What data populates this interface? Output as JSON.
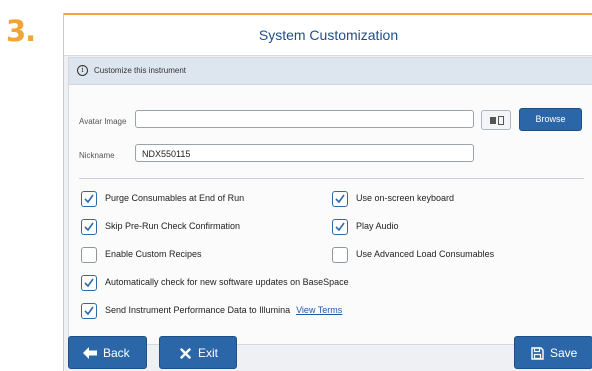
{
  "step_number": "3.",
  "window": {
    "title": "System Customization"
  },
  "info": {
    "text": "Customize this instrument"
  },
  "fields": {
    "avatar_label": "Avatar Image",
    "avatar_value": "",
    "nickname_label": "Nickname",
    "nickname_value": "NDX550115"
  },
  "buttons": {
    "browse": "Browse",
    "back": "Back",
    "exit": "Exit",
    "save": "Save"
  },
  "options": [
    {
      "label": "Purge Consumables at End of Run",
      "checked": true
    },
    {
      "label": "Use on-screen keyboard",
      "checked": true
    },
    {
      "label": "Skip Pre-Run Check Confirmation",
      "checked": true
    },
    {
      "label": "Play Audio",
      "checked": true
    },
    {
      "label": "Enable Custom Recipes",
      "checked": false
    },
    {
      "label": "Use Advanced Load Consumables",
      "checked": false
    },
    {
      "label": "Automatically check for new software updates on BaseSpace",
      "checked": true
    },
    {
      "label": "Send Instrument Performance Data to Illumina",
      "checked": true
    }
  ],
  "view_terms": "View Terms",
  "colors": {
    "accent": "#f2a33a",
    "primary": "#2b67a8",
    "title_text": "#1f4e8a"
  },
  "icons": [
    "info-icon",
    "image-select-icon",
    "check-icon",
    "arrow-left-icon",
    "x-icon",
    "floppy-disk-icon"
  ]
}
